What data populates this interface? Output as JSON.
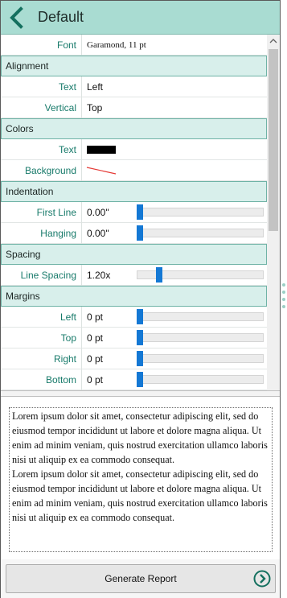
{
  "header": {
    "title": "Default",
    "back_icon": "chevron-left-icon"
  },
  "colors": {
    "accent": "#177a6a",
    "header_bg": "#a9dcd2",
    "section_bg": "#d8efeb",
    "slider_thumb": "#1478d4",
    "text_swatch": "#000000",
    "background_swatch": "none"
  },
  "font": {
    "label": "Font",
    "value": "Garamond, 11 pt"
  },
  "alignment": {
    "section": "Alignment",
    "text_label": "Text",
    "text_value": "Left",
    "vertical_label": "Vertical",
    "vertical_value": "Top"
  },
  "colors_section": {
    "section": "Colors",
    "text_label": "Text",
    "background_label": "Background"
  },
  "indentation": {
    "section": "Indentation",
    "first_line_label": "First Line",
    "first_line_value": "0.00\"",
    "first_line_level": 0,
    "hanging_label": "Hanging",
    "hanging_value": "0.00\"",
    "hanging_level": 0
  },
  "spacing": {
    "section": "Spacing",
    "line_spacing_label": "Line Spacing",
    "line_spacing_value": "1.20x",
    "line_spacing_level": 0.16
  },
  "margins": {
    "section": "Margins",
    "left_label": "Left",
    "left_value": "0 pt",
    "left_level": 0,
    "top_label": "Top",
    "top_value": "0 pt",
    "top_level": 0,
    "right_label": "Right",
    "right_value": "0 pt",
    "right_level": 0,
    "bottom_label": "Bottom",
    "bottom_value": "0 pt",
    "bottom_level": 0
  },
  "preview": {
    "paragraphs": [
      "Lorem ipsum dolor sit amet, consectetur adipiscing elit, sed do eiusmod tempor incididunt ut labore et dolore magna aliqua. Ut enim ad minim veniam, quis nostrud exercitation ullamco laboris nisi ut aliquip ex ea commodo consequat.",
      "Lorem ipsum dolor sit amet, consectetur adipiscing elit, sed do eiusmod tempor incididunt ut labore et dolore magna aliqua. Ut enim ad minim veniam, quis nostrud exercitation ullamco laboris nisi ut aliquip ex ea commodo consequat."
    ]
  },
  "footer": {
    "generate_label": "Generate Report",
    "generate_icon": "arrow-circle-right-icon"
  }
}
